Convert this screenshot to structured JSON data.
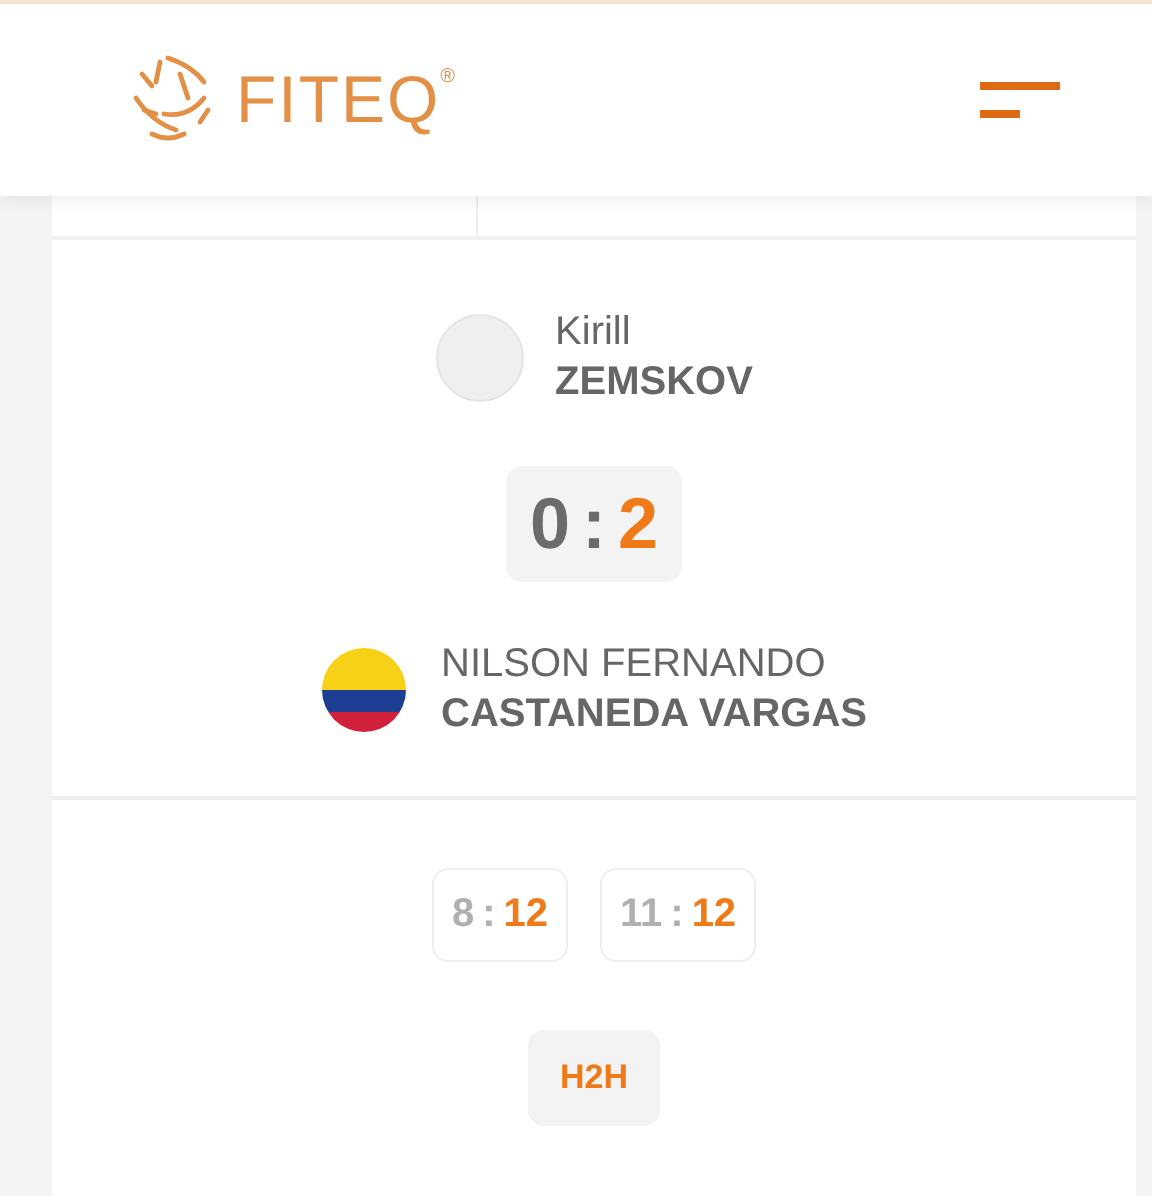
{
  "header": {
    "logo_text": "FITEQ",
    "logo_mark": "®"
  },
  "match": {
    "players": [
      {
        "first_name": "Kirill",
        "last_name": "ZEMSKOV",
        "kind": "placeholder"
      },
      {
        "first_name": "NILSON FERNANDO",
        "last_name": "CASTANEDA VARGAS",
        "kind": "flag"
      }
    ],
    "score": {
      "home": "0",
      "separator": ":",
      "away": "2",
      "home_won": false,
      "away_won": true
    },
    "sets": [
      {
        "home": "8",
        "separator": ":",
        "away": "12",
        "home_won": false,
        "away_won": true
      },
      {
        "home": "11",
        "separator": ":",
        "away": "12",
        "home_won": false,
        "away_won": true
      }
    ],
    "h2h_button": "H2H"
  }
}
